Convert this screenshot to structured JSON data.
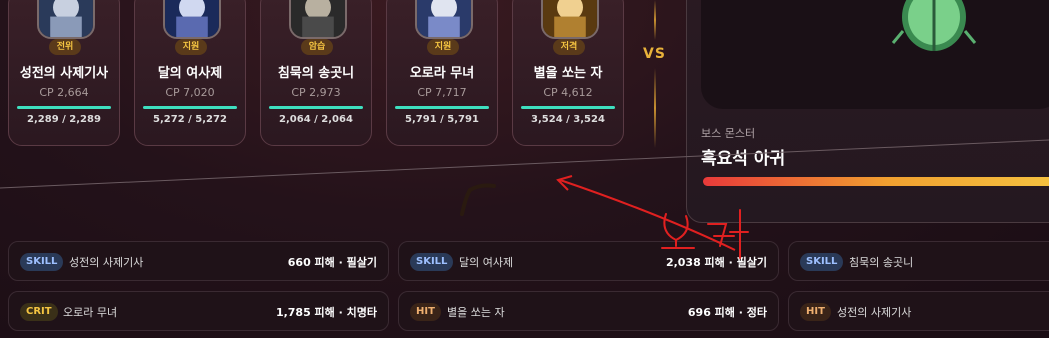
{
  "heroes": [
    {
      "name": "성전의 사제기사",
      "role": "전위",
      "cp": "CP 2,664",
      "hp_text": "2,289 / 2,289",
      "hp_fraction": 1.0
    },
    {
      "name": "달의 여사제",
      "role": "지원",
      "cp": "CP 7,020",
      "hp_text": "5,272 / 5,272",
      "hp_fraction": 1.0
    },
    {
      "name": "침묵의 송곳니",
      "role": "암습",
      "cp": "CP 2,973",
      "hp_text": "2,064 / 2,064",
      "hp_fraction": 1.0
    },
    {
      "name": "오로라 무녀",
      "role": "지원",
      "cp": "CP 7,717",
      "hp_text": "5,791 / 5,791",
      "hp_fraction": 1.0
    },
    {
      "name": "별을 쏘는 자",
      "role": "저격",
      "cp": "CP 4,612",
      "hp_text": "3,524 / 3,524",
      "hp_fraction": 1.0
    }
  ],
  "versus": "VS",
  "boss": {
    "subtitle": "보스 몬스터",
    "name": "흑요석 아귀",
    "hp_fraction": 1.0
  },
  "battle_log": [
    {
      "type": "SKILL",
      "name": "성전의 사제기사",
      "result": "660 피해 · 필살기"
    },
    {
      "type": "SKILL",
      "name": "달의 여사제",
      "result": "2,038 피해 · 필살기"
    },
    {
      "type": "SKILL",
      "name": "침묵의 송곳니",
      "result": ""
    },
    {
      "type": "CRIT",
      "name": "오로라 무녀",
      "result": "1,785 피해 · 치명타"
    },
    {
      "type": "HIT",
      "name": "별을 쏘는 자",
      "result": "696 피해 · 정타"
    },
    {
      "type": "HIT",
      "name": "성전의 사제기사",
      "result": ""
    }
  ],
  "colors": {
    "accent_gold": "#f5c542",
    "hp_teal": "#3ee0c0",
    "boss_hp": "#e83a3a",
    "annotation_red": "#e02020"
  }
}
